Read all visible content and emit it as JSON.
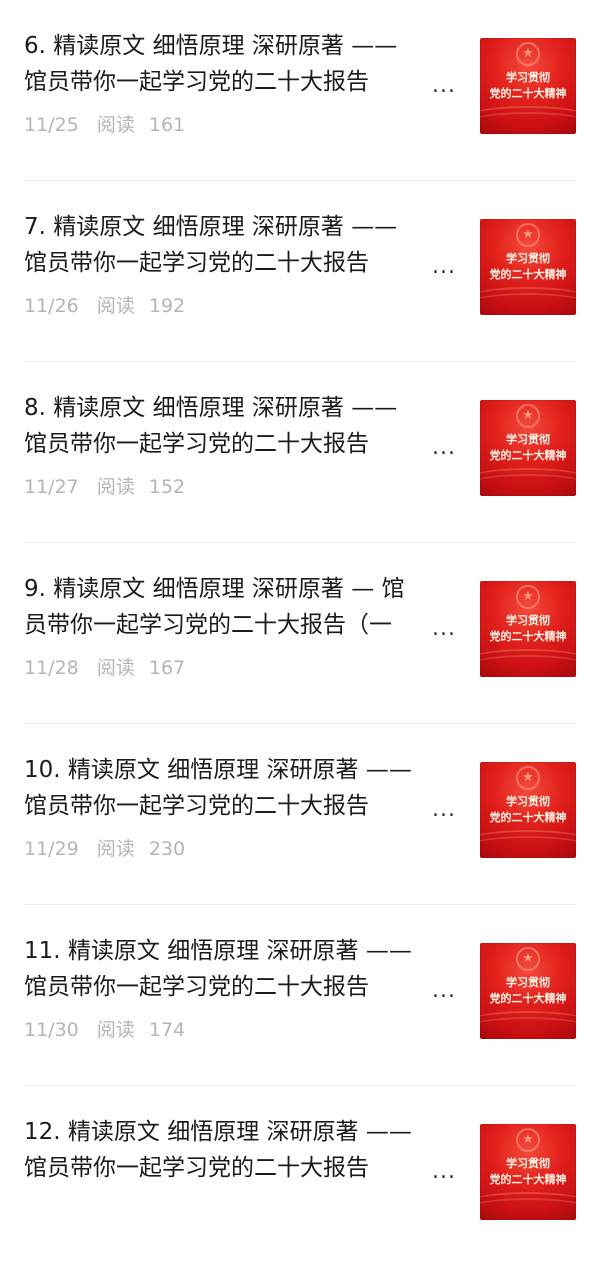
{
  "articles": [
    {
      "title_line1": "6. 精读原文 细悟原理 深研原著 ——",
      "title_line2": "馆员带你一起学习党的二十大报告",
      "ellipsis": "...",
      "date": "11/25",
      "read_label": "阅读",
      "read_count": "161",
      "thumb_caption_line1": "学习贯彻",
      "thumb_caption_line2": "党的二十大精神"
    },
    {
      "title_line1": "7. 精读原文 细悟原理 深研原著 ——",
      "title_line2": "馆员带你一起学习党的二十大报告",
      "ellipsis": "...",
      "date": "11/26",
      "read_label": "阅读",
      "read_count": "192",
      "thumb_caption_line1": "学习贯彻",
      "thumb_caption_line2": "党的二十大精神"
    },
    {
      "title_line1": "8. 精读原文 细悟原理 深研原著 ——",
      "title_line2": "馆员带你一起学习党的二十大报告",
      "ellipsis": "...",
      "date": "11/27",
      "read_label": "阅读",
      "read_count": "152",
      "thumb_caption_line1": "学习贯彻",
      "thumb_caption_line2": "党的二十大精神"
    },
    {
      "title_line1": "9. 精读原文 细悟原理 深研原著 — 馆",
      "title_line2": "员带你一起学习党的二十大报告（一",
      "ellipsis": "...",
      "date": "11/28",
      "read_label": "阅读",
      "read_count": "167",
      "thumb_caption_line1": "学习贯彻",
      "thumb_caption_line2": "党的二十大精神"
    },
    {
      "title_line1": "10. 精读原文 细悟原理 深研原著 ——",
      "title_line2": "馆员带你一起学习党的二十大报告",
      "ellipsis": "...",
      "date": "11/29",
      "read_label": "阅读",
      "read_count": "230",
      "thumb_caption_line1": "学习贯彻",
      "thumb_caption_line2": "党的二十大精神"
    },
    {
      "title_line1": "11. 精读原文 细悟原理 深研原著 ——",
      "title_line2": "馆员带你一起学习党的二十大报告",
      "ellipsis": "...",
      "date": "11/30",
      "read_label": "阅读",
      "read_count": "174",
      "thumb_caption_line1": "学习贯彻",
      "thumb_caption_line2": "党的二十大精神"
    },
    {
      "title_line1": "12. 精读原文 细悟原理 深研原著 ——",
      "title_line2": "馆员带你一起学习党的二十大报告",
      "ellipsis": "...",
      "date": "",
      "read_label": "",
      "read_count": "",
      "thumb_caption_line1": "学习贯彻",
      "thumb_caption_line2": "党的二十大精神"
    }
  ]
}
